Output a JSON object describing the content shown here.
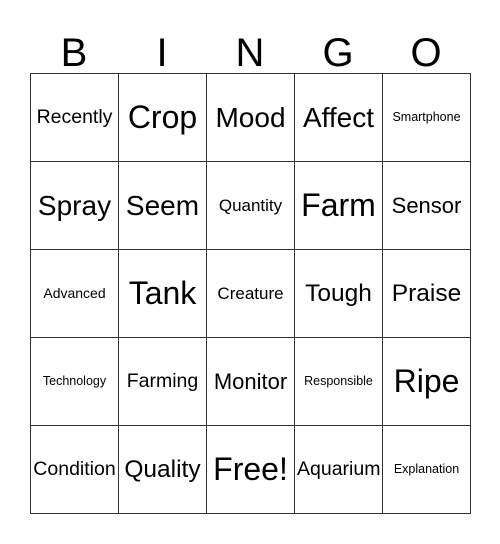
{
  "card": {
    "header_letters": [
      "B",
      "I",
      "N",
      "G",
      "O"
    ],
    "rows": [
      [
        {
          "text": "Recently",
          "size": "fs-m"
        },
        {
          "text": "Crop",
          "size": "fs-xxl"
        },
        {
          "text": "Mood",
          "size": "fs-xl"
        },
        {
          "text": "Affect",
          "size": "fs-xl"
        },
        {
          "text": "Smartphone",
          "size": "fs-xs"
        }
      ],
      [
        {
          "text": "Spray",
          "size": "fs-xl"
        },
        {
          "text": "Seem",
          "size": "fs-xl"
        },
        {
          "text": "Quantity",
          "size": "fs-sm"
        },
        {
          "text": "Farm",
          "size": "fs-xxl"
        },
        {
          "text": "Sensor",
          "size": "fs-ml"
        }
      ],
      [
        {
          "text": "Advanced",
          "size": "fs-s"
        },
        {
          "text": "Tank",
          "size": "fs-xxl"
        },
        {
          "text": "Creature",
          "size": "fs-sm"
        },
        {
          "text": "Tough",
          "size": "fs-l"
        },
        {
          "text": "Praise",
          "size": "fs-l"
        }
      ],
      [
        {
          "text": "Technology",
          "size": "fs-xs"
        },
        {
          "text": "Farming",
          "size": "fs-m"
        },
        {
          "text": "Monitor",
          "size": "fs-ml"
        },
        {
          "text": "Responsible",
          "size": "fs-xs"
        },
        {
          "text": "Ripe",
          "size": "fs-xxl"
        }
      ],
      [
        {
          "text": "Condition",
          "size": "fs-m"
        },
        {
          "text": "Quality",
          "size": "fs-l"
        },
        {
          "text": "Free!",
          "size": "fs-xxl"
        },
        {
          "text": "Aquarium",
          "size": "fs-m"
        },
        {
          "text": "Explanation",
          "size": "fs-xs"
        }
      ]
    ],
    "colors": {
      "background": "#ffffff",
      "text": "#000000",
      "grid_line": "#333333"
    }
  }
}
